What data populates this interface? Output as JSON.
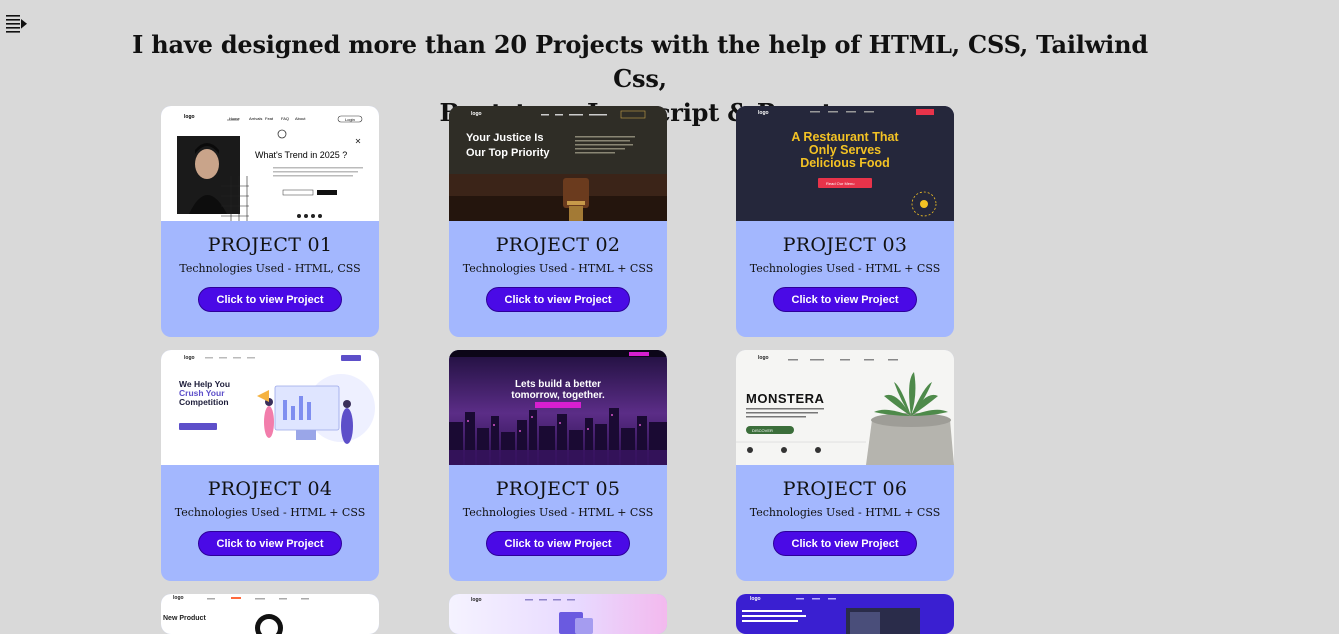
{
  "menu": {
    "icon": "menu-lines-icon"
  },
  "heading": {
    "line1": "I have designed more than 20 Projects with the help of HTML, CSS, Tailwind Css,",
    "line2": "Bootstrap, Javascript & React."
  },
  "projects": [
    {
      "title": "PROJECT 01",
      "tech": "Technologies Used - HTML, CSS",
      "button": "Click to view Project",
      "thumb": {
        "logo": "logo",
        "headline": "What's Trend in 2025 ?",
        "nav": [
          "Home",
          "Arrivals",
          "Feat",
          "FAQ",
          "About"
        ],
        "cta": "Login"
      }
    },
    {
      "title": "PROJECT 02",
      "tech": "Technologies Used - HTML + CSS",
      "button": "Click to view Project",
      "thumb": {
        "logo": "logo",
        "headline1": "Your Justice Is",
        "headline2": "Our Top Priority"
      }
    },
    {
      "title": "PROJECT 03",
      "tech": "Technologies Used - HTML + CSS",
      "button": "Click to view Project",
      "thumb": {
        "logo": "logo",
        "headline1": "A Restaurant That",
        "headline2": "Only Serves",
        "headline3": "Delicious Food",
        "cta": "Read Our Menu"
      }
    },
    {
      "title": "PROJECT 04",
      "tech": "Technologies Used - HTML + CSS",
      "button": "Click to view Project",
      "thumb": {
        "logo": "logo",
        "headline1": "We Help You",
        "headline2": "Crush Your",
        "headline3": "Competition"
      }
    },
    {
      "title": "PROJECT 05",
      "tech": "Technologies Used - HTML + CSS",
      "button": "Click to view Project",
      "thumb": {
        "headline1": "Lets build a better",
        "headline2": "tomorrow, together."
      }
    },
    {
      "title": "PROJECT 06",
      "tech": "Technologies Used - HTML + CSS",
      "button": "Click to view Project",
      "thumb": {
        "logo": "logo",
        "headline": "MONSTERA",
        "cta": "DISCOVER"
      }
    }
  ],
  "partial_row": [
    {
      "logo": "logo",
      "headline": "New Product"
    },
    {
      "logo": "logo"
    },
    {
      "logo": "logo"
    }
  ],
  "colors": {
    "background": "#d9d9d9",
    "card": "#a3b7fe",
    "button": "#4a0ae6"
  }
}
